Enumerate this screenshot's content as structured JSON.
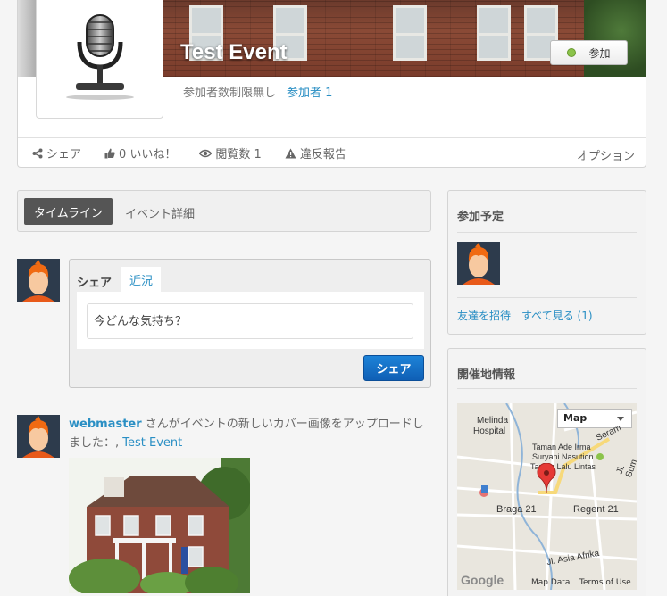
{
  "event": {
    "title": "Test Event",
    "join_label": "参加",
    "meta_limit": "参加者数制限無し",
    "meta_participants": "参加者 1"
  },
  "actions": {
    "share": "シェア",
    "like": "0 いいね！",
    "views": "閲覧数 1",
    "report": "違反報告",
    "option": "オプション"
  },
  "tabs": {
    "timeline": "タイムライン",
    "details": "イベント詳細"
  },
  "composer": {
    "tab_share": "シェア",
    "tab_status": "近況",
    "placeholder": "今どんな気持ち？",
    "submit": "シェア"
  },
  "post": {
    "user": "webmaster",
    "text": " さんがイベントの新しいカバー画像をアップロードしました：, ",
    "event_link": "Test Event"
  },
  "sidebar": {
    "attending_title": "参加予定",
    "invite_link": "友達を招待",
    "see_all_link": "すべて見る (1)",
    "location_title": "開催地情報",
    "map": {
      "type_select": "Map",
      "labels": [
        "Melinda",
        "Hospital",
        "Taman Ade Irma",
        "Suryani Nasution",
        "Taman Lalu Lintas",
        "Braga 21",
        "Regent 21",
        "Jl. Asia Afrika",
        "Seram",
        "Jl. Sum"
      ],
      "logo": "Google",
      "footer_data": "Map Data",
      "footer_terms": "Terms of Use"
    }
  }
}
